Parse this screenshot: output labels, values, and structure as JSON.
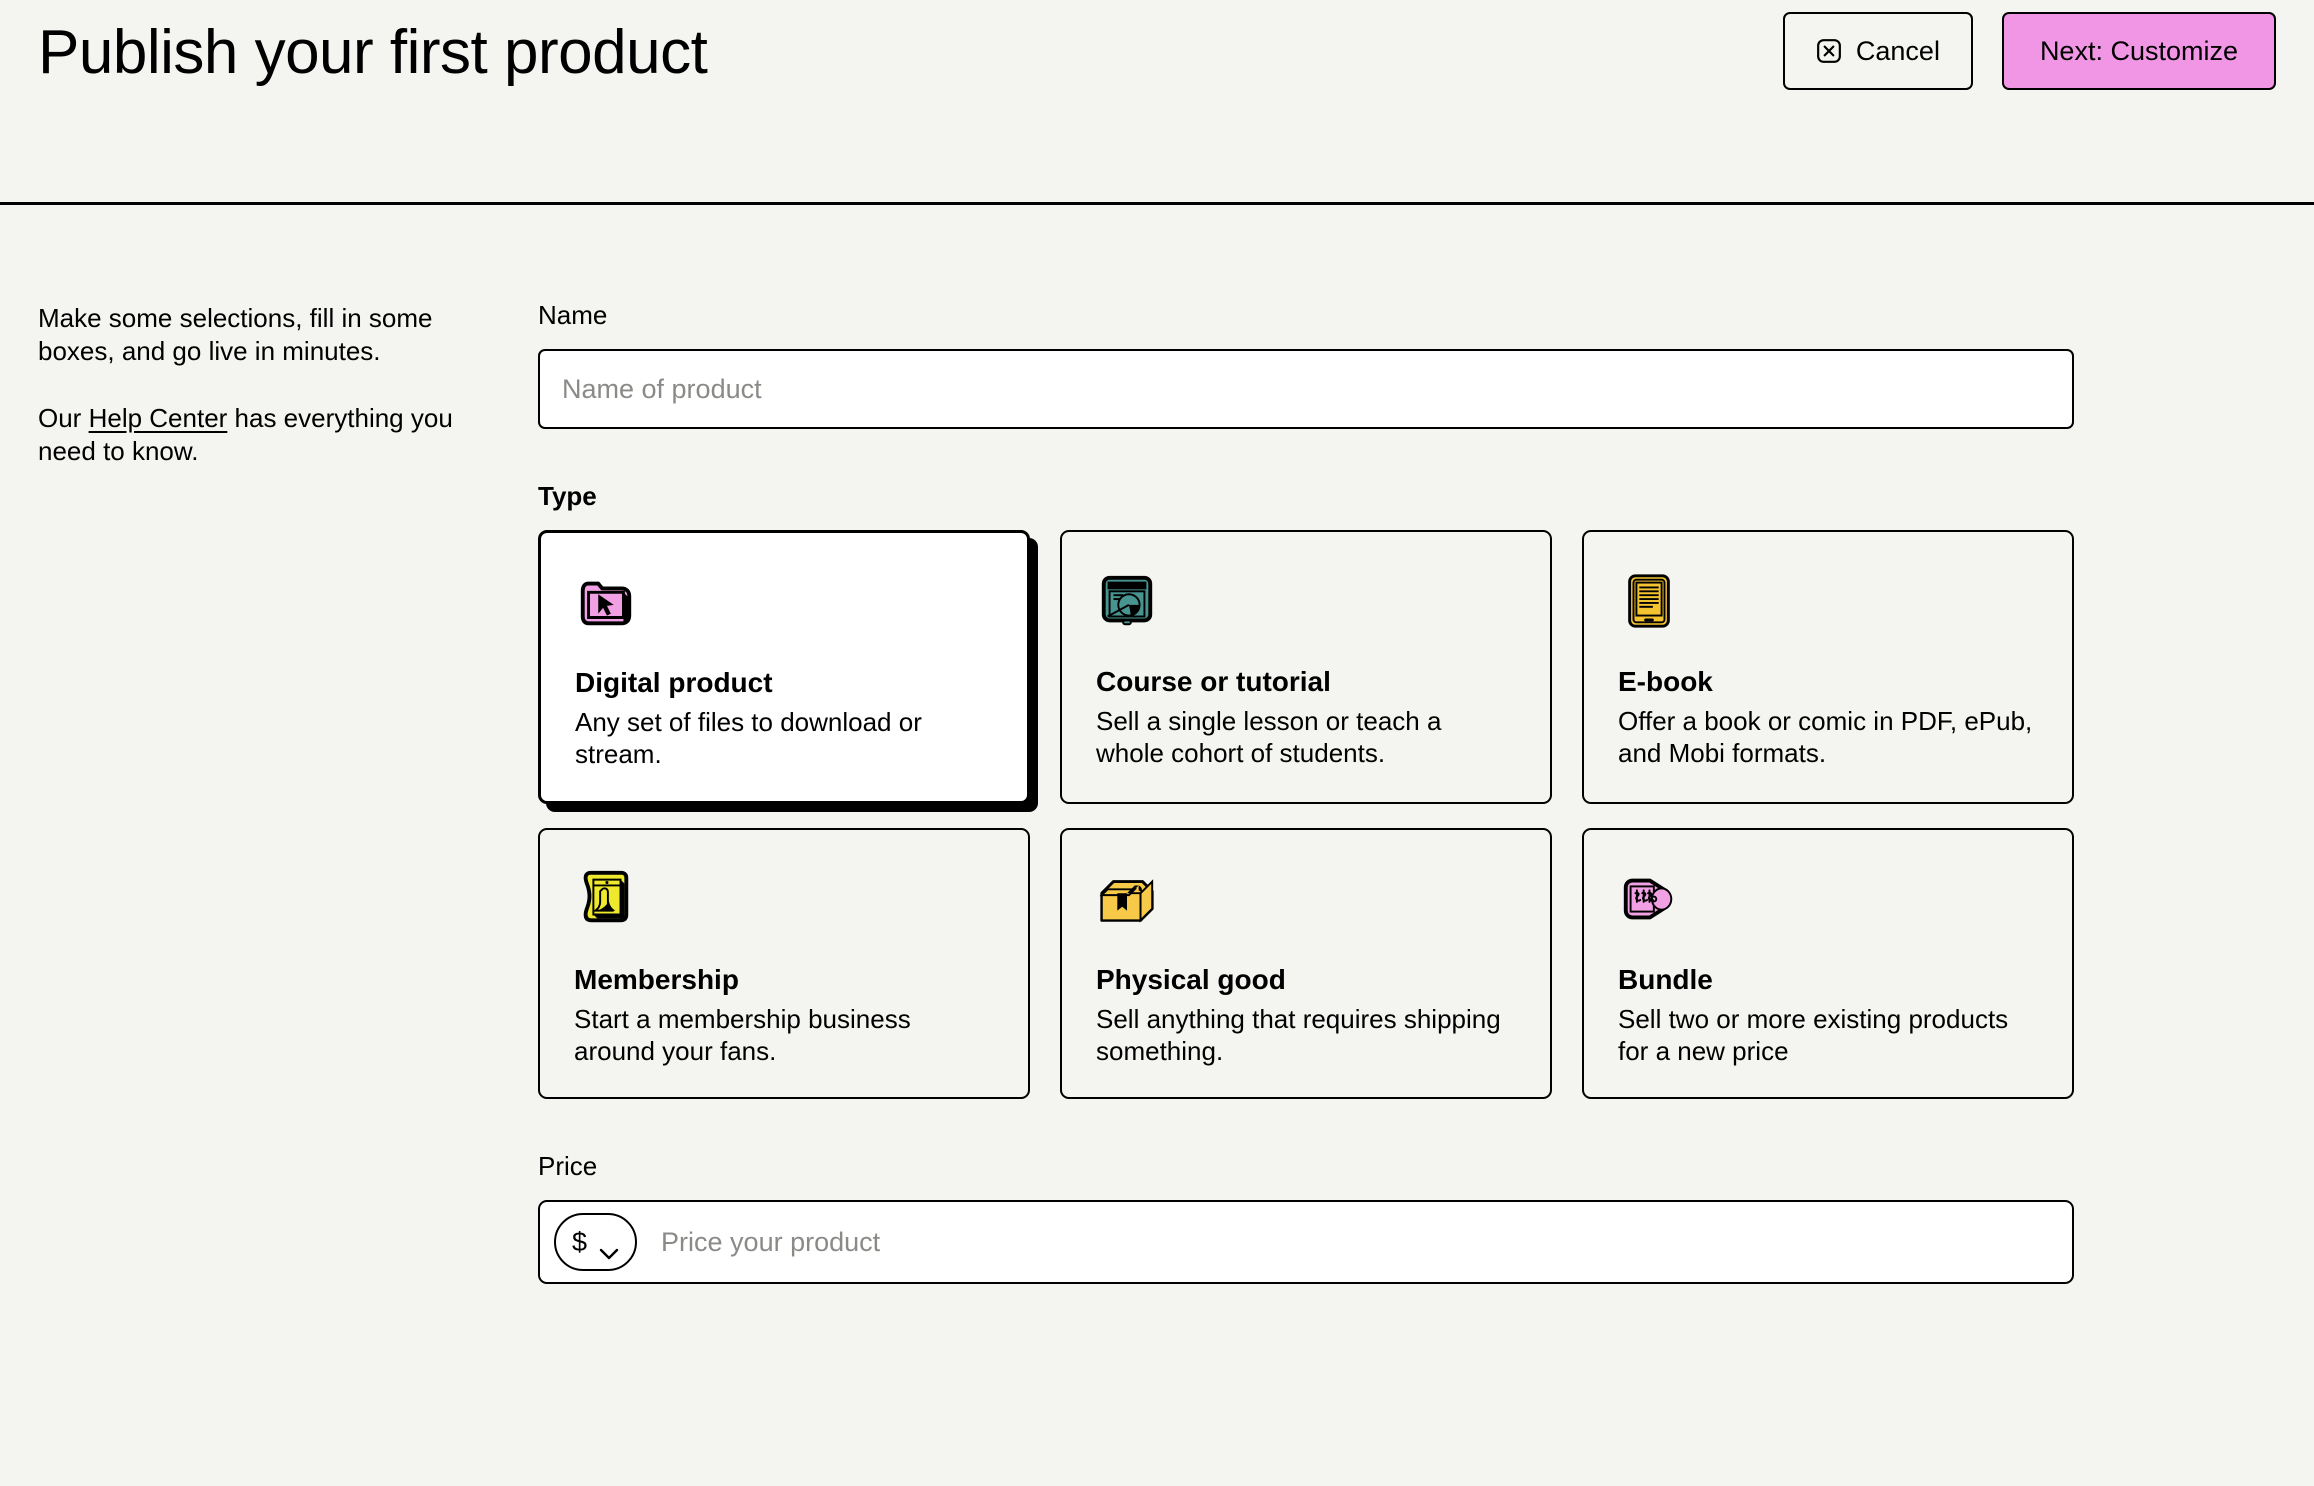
{
  "header": {
    "title": "Publish your first product",
    "cancel_label": "Cancel",
    "cancel_icon": "close-square-icon",
    "next_label": "Next: Customize",
    "next_bg": "#f196e5"
  },
  "sidebar": {
    "intro": "Make some selections, fill in some boxes, and go live in minutes.",
    "help_prefix": "Our ",
    "help_link": "Help Center",
    "help_suffix": " has everything you need to know."
  },
  "form": {
    "name": {
      "label": "Name",
      "placeholder": "Name of product",
      "value": ""
    },
    "type": {
      "label": "Type",
      "selected": "Digital product",
      "options": [
        {
          "title": "Digital product",
          "desc": "Any set of files to download or stream.",
          "icon": "folder-cursor-icon",
          "color": "#f2a0e4",
          "selected": true
        },
        {
          "title": "Course or tutorial",
          "desc": "Sell a single lesson or teach a whole cohort of students.",
          "icon": "presentation-board-icon",
          "color": "#479490",
          "selected": false
        },
        {
          "title": "E-book",
          "desc": "Offer a book or comic in PDF, ePub, and Mobi formats.",
          "icon": "e-reader-icon",
          "color": "#f4c430",
          "selected": false
        },
        {
          "title": "Membership",
          "desc": "Start a membership business around your fans.",
          "icon": "membership-card-icon",
          "color": "#efe92e",
          "selected": false
        },
        {
          "title": "Physical good",
          "desc": "Sell anything that requires shipping something.",
          "icon": "shipping-box-icon",
          "color": "#f7c948",
          "selected": false
        },
        {
          "title": "Bundle",
          "desc": "Sell two or more existing products for a new price",
          "icon": "price-tag-icon",
          "color": "#f2a0e4",
          "selected": false
        }
      ]
    },
    "price": {
      "label": "Price",
      "currency_symbol": "$",
      "currency_caret": "chevron-down-icon",
      "placeholder": "Price your product",
      "value": ""
    }
  }
}
